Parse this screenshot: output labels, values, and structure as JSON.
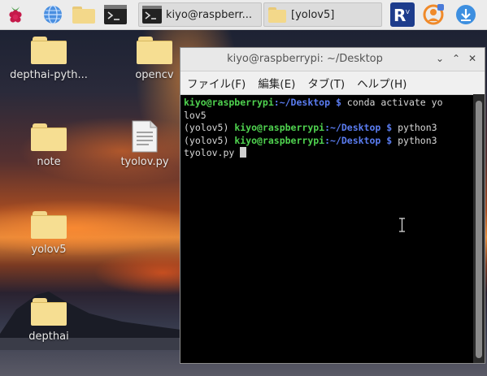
{
  "taskbar": {
    "launchers": [
      {
        "name": "raspberry-menu-icon"
      },
      {
        "name": "browser-globe-icon"
      },
      {
        "name": "file-manager-icon"
      },
      {
        "name": "terminal-launcher-icon"
      }
    ],
    "tasks": [
      {
        "label": "kiyo@raspberr...",
        "icon": "terminal-icon"
      },
      {
        "label": "[yolov5]",
        "icon": "folder-icon"
      }
    ],
    "tray": [
      {
        "name": "vnc-icon"
      },
      {
        "name": "user-update-icon"
      },
      {
        "name": "download-icon"
      }
    ]
  },
  "desktop": {
    "icons": [
      {
        "label": "depthai-pyth...",
        "type": "folder"
      },
      {
        "label": "opencv",
        "type": "folder"
      },
      {
        "label": "note",
        "type": "folder"
      },
      {
        "label": "tyolov.py",
        "type": "file"
      },
      {
        "label": "yolov5",
        "type": "folder"
      },
      {
        "label": "depthai",
        "type": "folder"
      }
    ]
  },
  "terminal": {
    "title": "kiyo@raspberrypi: ~/Desktop",
    "menu": [
      "ファイル(F)",
      "編集(E)",
      "タブ(T)",
      "ヘルプ(H)"
    ],
    "lines": [
      {
        "env": "",
        "user": "kiyo@raspberrypi",
        "path": ":~/Desktop $",
        "cmd": " conda activate yo"
      },
      {
        "plain": "lov5"
      },
      {
        "env": "(yolov5) ",
        "user": "kiyo@raspberrypi",
        "path": ":~/Desktop $",
        "cmd": " python3"
      },
      {
        "env": "(yolov5) ",
        "user": "kiyo@raspberrypi",
        "path": ":~/Desktop $",
        "cmd": " python3"
      },
      {
        "plain": "tyolov.py "
      }
    ]
  },
  "colors": {
    "prompt_user": "#4fd24f",
    "prompt_path": "#5a7cf0",
    "terminal_bg": "#000000",
    "taskbar_bg": "#ececec"
  }
}
